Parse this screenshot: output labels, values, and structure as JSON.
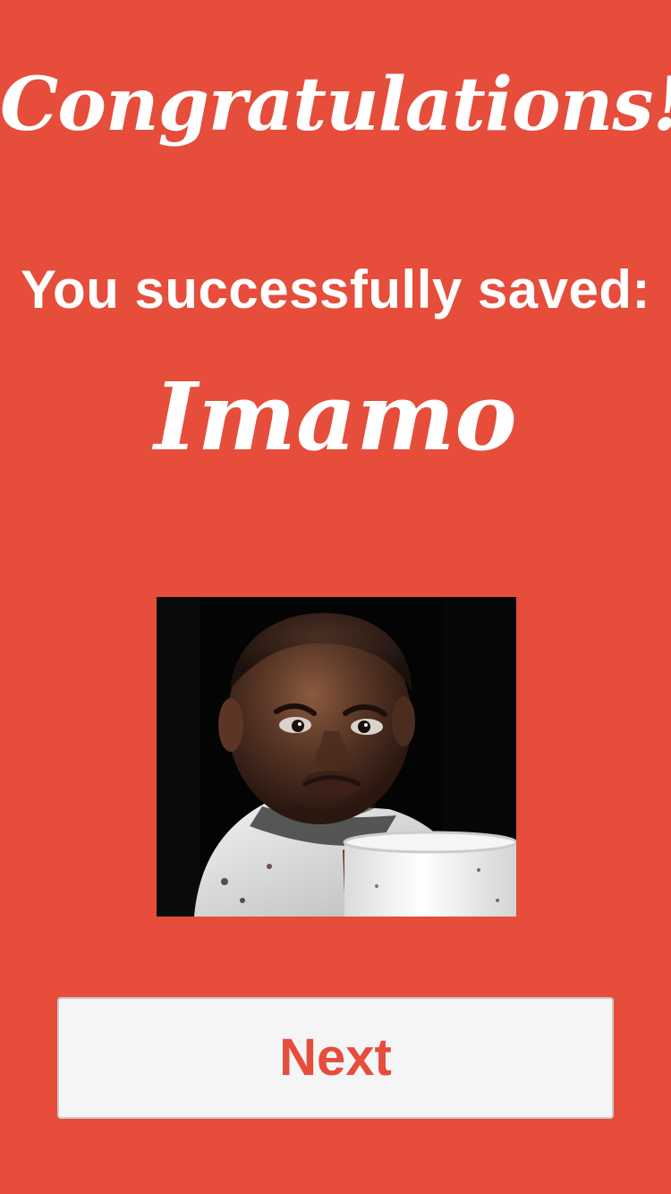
{
  "theme": {
    "background": "#e64d3b",
    "text": "#ffffff",
    "button_background": "#f5f5f5",
    "button_text": "#e64d3b"
  },
  "header": {
    "title": "Congratulations!",
    "subtitle": "You successfully saved:"
  },
  "profile": {
    "name": "Imamo",
    "photo_icon": "child-photo"
  },
  "actions": {
    "next_label": "Next"
  }
}
